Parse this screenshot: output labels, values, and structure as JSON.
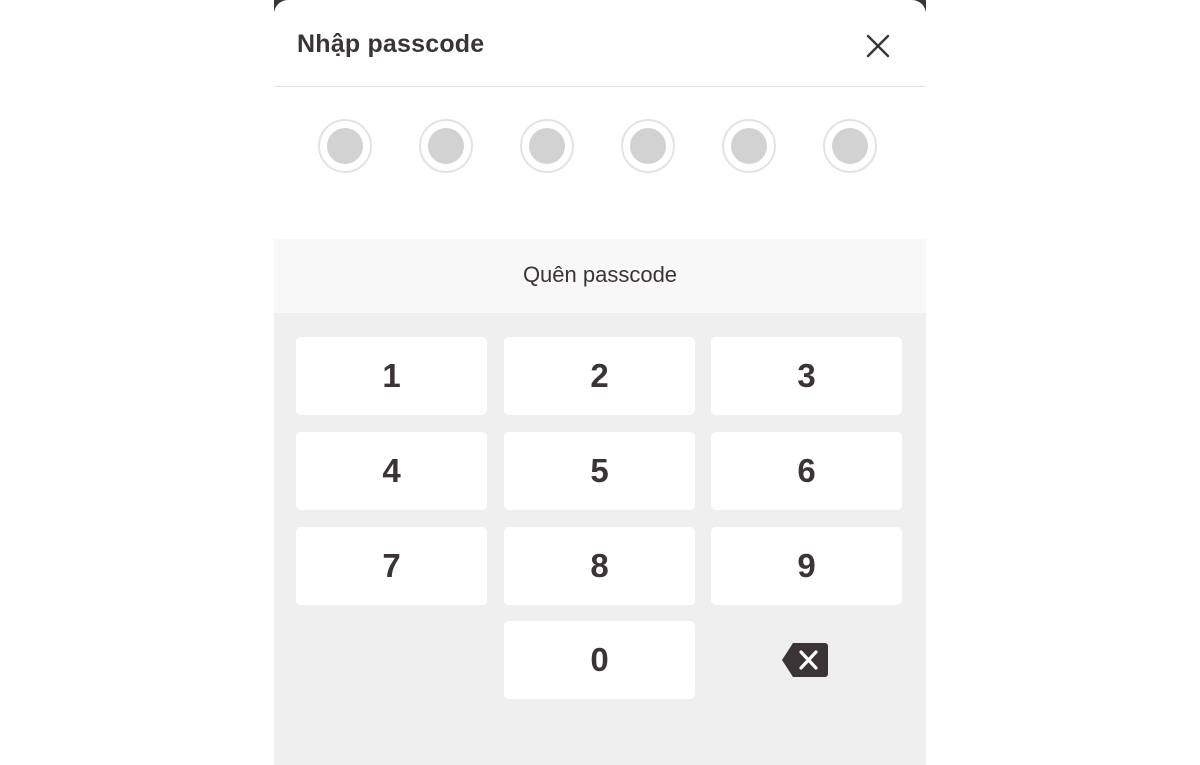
{
  "dialog": {
    "title": "Nhập passcode",
    "close_icon": "close-icon"
  },
  "passcode": {
    "length": 6,
    "entered": 0
  },
  "forgot_label": "Quên passcode",
  "keypad": {
    "keys": [
      "1",
      "2",
      "3",
      "4",
      "5",
      "6",
      "7",
      "8",
      "9",
      "0"
    ],
    "backspace_icon": "backspace-icon"
  },
  "colors": {
    "text": "#3b3437",
    "keypad_bg": "#efefef",
    "forgot_bg": "#f8f8f8",
    "dot_fill": "#d2d2d2",
    "dot_ring": "#e3e3e3"
  }
}
